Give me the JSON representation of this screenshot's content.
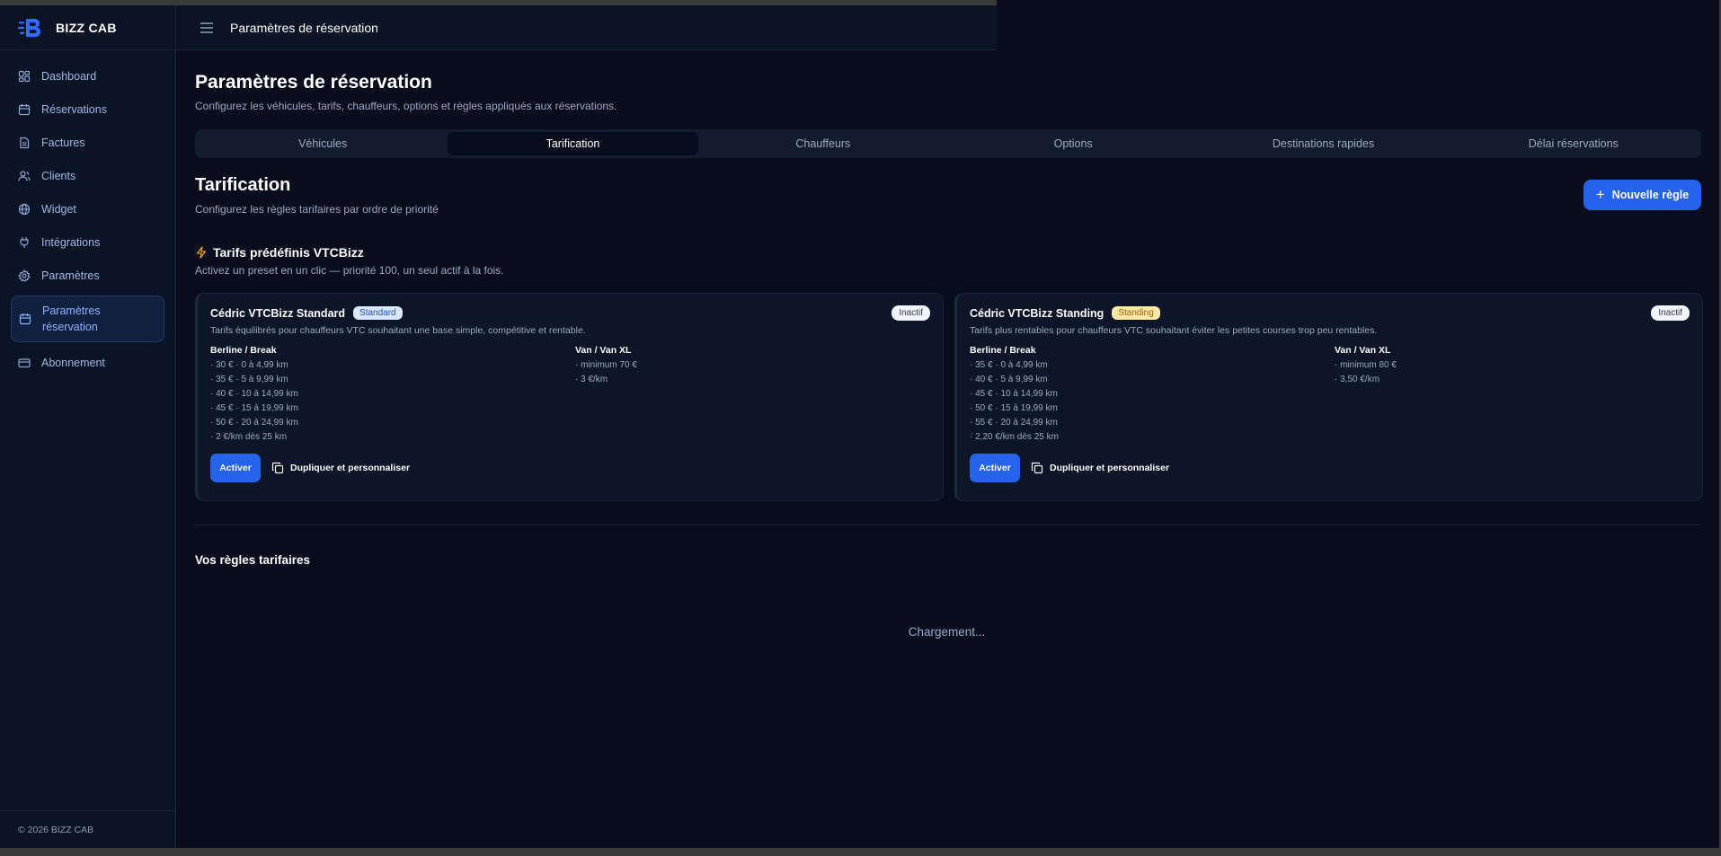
{
  "brand": {
    "name": "BIZZ CAB",
    "accent": "#2563eb"
  },
  "sidebar": {
    "items": [
      {
        "label": "Dashboard",
        "icon": "dashboard-icon"
      },
      {
        "label": "Réservations",
        "icon": "calendar-icon"
      },
      {
        "label": "Factures",
        "icon": "file-icon"
      },
      {
        "label": "Clients",
        "icon": "users-icon"
      },
      {
        "label": "Widget",
        "icon": "globe-icon"
      },
      {
        "label": "Intégrations",
        "icon": "plug-icon"
      },
      {
        "label": "Paramètres",
        "icon": "gear-icon"
      },
      {
        "label": "Paramètres réservation",
        "icon": "calendar-icon",
        "active": true
      },
      {
        "label": "Abonnement",
        "icon": "card-icon"
      }
    ],
    "footer": "© 2026 BIZZ CAB"
  },
  "topbar": {
    "title": "Paramètres de réservation"
  },
  "page": {
    "title": "Paramètres de réservation",
    "subtitle": "Configurez les véhicules, tarifs, chauffeurs, options et règles appliqués aux réservations."
  },
  "tabs": [
    {
      "label": "Véhicules"
    },
    {
      "label": "Tarification",
      "active": true
    },
    {
      "label": "Chauffeurs"
    },
    {
      "label": "Options"
    },
    {
      "label": "Destinations rapides"
    },
    {
      "label": "Délai réservations"
    }
  ],
  "pricing": {
    "title": "Tarification",
    "subtitle": "Configurez les règles tarifaires par ordre de priorité",
    "new_rule_label": "Nouvelle règle",
    "presets_title": "Tarifs prédéfinis VTCBizz",
    "presets_subtitle": "Activez un preset en un clic — priorité 100, un seul actif à la fois.",
    "presets": [
      {
        "name": "Cédric VTCBizz Standard",
        "badge": "Standard",
        "status": "Inactif",
        "description": "Tarifs équilibrés pour chauffeurs VTC souhaitant une base simple, compétitive et rentable.",
        "col1_title": "Berline / Break",
        "col1_lines": [
          "· 30 € · 0 à 4,99 km",
          "· 35 € · 5 à 9,99 km",
          "· 40 € · 10 à 14,99 km",
          "· 45 € · 15 à 19,99 km",
          "· 50 € · 20 à 24,99 km",
          "· 2 €/km dès 25 km"
        ],
        "col2_title": "Van / Van XL",
        "col2_lines": [
          "· minimum 70 €",
          "· 3 €/km"
        ],
        "activate_label": "Activer",
        "duplicate_label": "Dupliquer et personnaliser"
      },
      {
        "name": "Cédric VTCBizz Standing",
        "badge": "Standing",
        "status": "Inactif",
        "description": "Tarifs plus rentables pour chauffeurs VTC souhaitant éviter les petites courses trop peu rentables.",
        "col1_title": "Berline / Break",
        "col1_lines": [
          "· 35 € · 0 à 4,99 km",
          "· 40 € · 5 à 9,99 km",
          "· 45 € · 10 à 14,99 km",
          "· 50 € · 15 à 19,99 km",
          "· 55 € · 20 à 24,99 km",
          "· 2,20 €/km dès 25 km"
        ],
        "col2_title": "Van / Van XL",
        "col2_lines": [
          "· minimum 80 €",
          "· 3,50 €/km"
        ],
        "activate_label": "Activer",
        "duplicate_label": "Dupliquer et personnaliser"
      }
    ],
    "rules_title": "Vos règles tarifaires",
    "loading_text": "Chargement..."
  }
}
